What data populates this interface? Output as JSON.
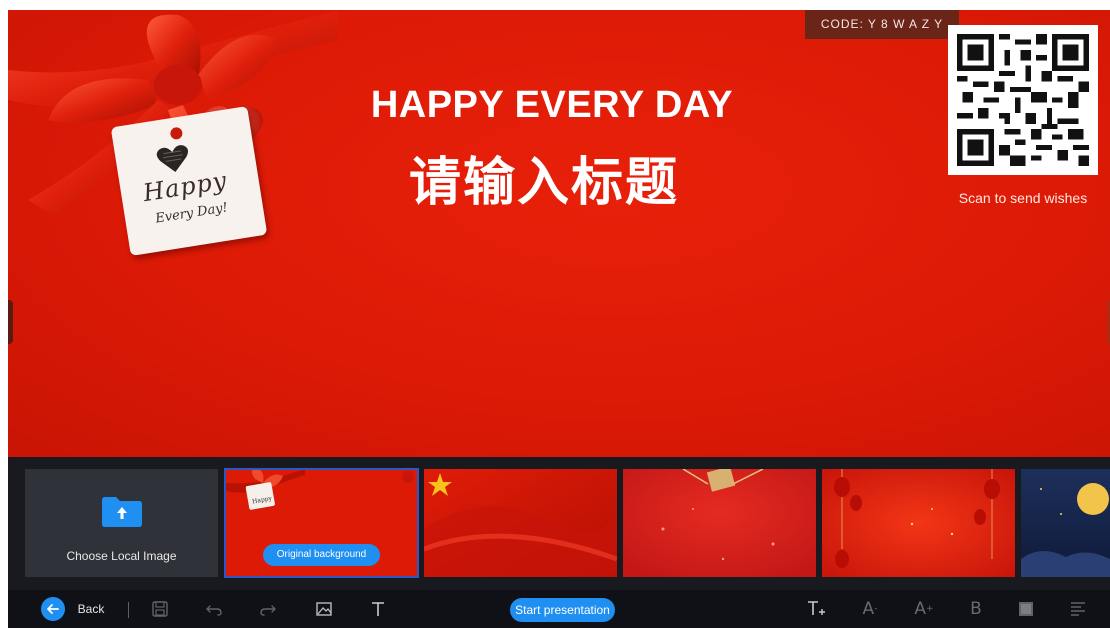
{
  "stage": {
    "title_en": "HAPPY EVERY DAY",
    "title_cn": "请输入标题",
    "code_badge": "CODE: Y 8 W A Z Y",
    "qr_caption": "Scan to send wishes",
    "tag_line1": "Happy",
    "tag_line2": "Every Day!"
  },
  "backgrounds": {
    "choose_label": "Choose Local Image",
    "original_badge": "Original background",
    "thumbs": [
      {
        "name": "thumb-original-background",
        "selected": true
      },
      {
        "name": "thumb-red-silk",
        "selected": false
      },
      {
        "name": "thumb-red-gift",
        "selected": false
      },
      {
        "name": "thumb-red-lanterns",
        "selected": false
      },
      {
        "name": "thumb-night-moon",
        "selected": false
      }
    ]
  },
  "toolbar": {
    "back_label": "Back",
    "start_label": "Start presentation",
    "font_decrease_label": "A",
    "font_increase_label": "A",
    "bold_label": "B",
    "icons": [
      "back-icon",
      "save-icon",
      "undo-icon",
      "redo-icon",
      "image-icon",
      "text-icon",
      "text-style-icon",
      "font-decrease-icon",
      "font-increase-icon",
      "bold-icon",
      "fill-color-icon",
      "align-icon"
    ]
  },
  "colors": {
    "stage_red": "#dc1a06",
    "accent_blue": "#1f8ff2",
    "toolbar_bg": "#0f1116"
  }
}
